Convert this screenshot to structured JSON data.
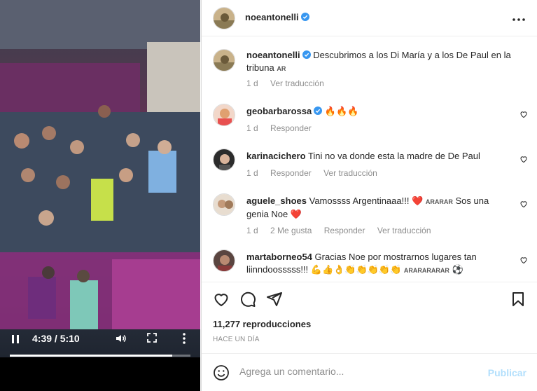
{
  "video": {
    "time": "4:39 / 5:10",
    "progress": 0.9
  },
  "header": {
    "username": "noeantonelli",
    "more_icon": "more-horizontal-icon"
  },
  "caption": {
    "username": "noeantonelli",
    "text": "Descubrimos a los Di María y a los De Paul en la tribuna",
    "tag": "AR",
    "time": "1 d",
    "translate": "Ver traducción"
  },
  "comments": [
    {
      "username": "geobarbarossa",
      "verified": true,
      "text": "🔥🔥🔥",
      "time": "1 d",
      "reply": "Responder"
    },
    {
      "username": "karinacichero",
      "text": "Tini no va donde esta la madre de De Paul",
      "time": "1 d",
      "reply": "Responder",
      "translate": "Ver traducción"
    },
    {
      "username": "aguele_shoes",
      "text_a": "Vamossss Argentinaaa!!! ❤️",
      "tag": "ARARAR",
      "text_b": "Sos una genia Noe ❤️",
      "time": "1 d",
      "likes": "2 Me gusta",
      "reply": "Responder",
      "translate": "Ver traducción"
    },
    {
      "username": "martaborneo54",
      "text_a": "Gracias Noe por mostrarnos lugares tan liinndoosssss!!! 💪👍👌👏👏👏👏👏",
      "tag": "ARARARARAR",
      "text_b": "⚽"
    }
  ],
  "actions": {
    "views": "11,277 reproducciones",
    "ago": "HACE UN DÍA"
  },
  "add_comment": {
    "placeholder": "Agrega un comentario...",
    "publish": "Publicar"
  },
  "colors": {
    "verified": "#3897f0",
    "muted": "#8e8e8e",
    "publish_disabled": "#b2dffc",
    "heart_red": "#ed4956"
  }
}
